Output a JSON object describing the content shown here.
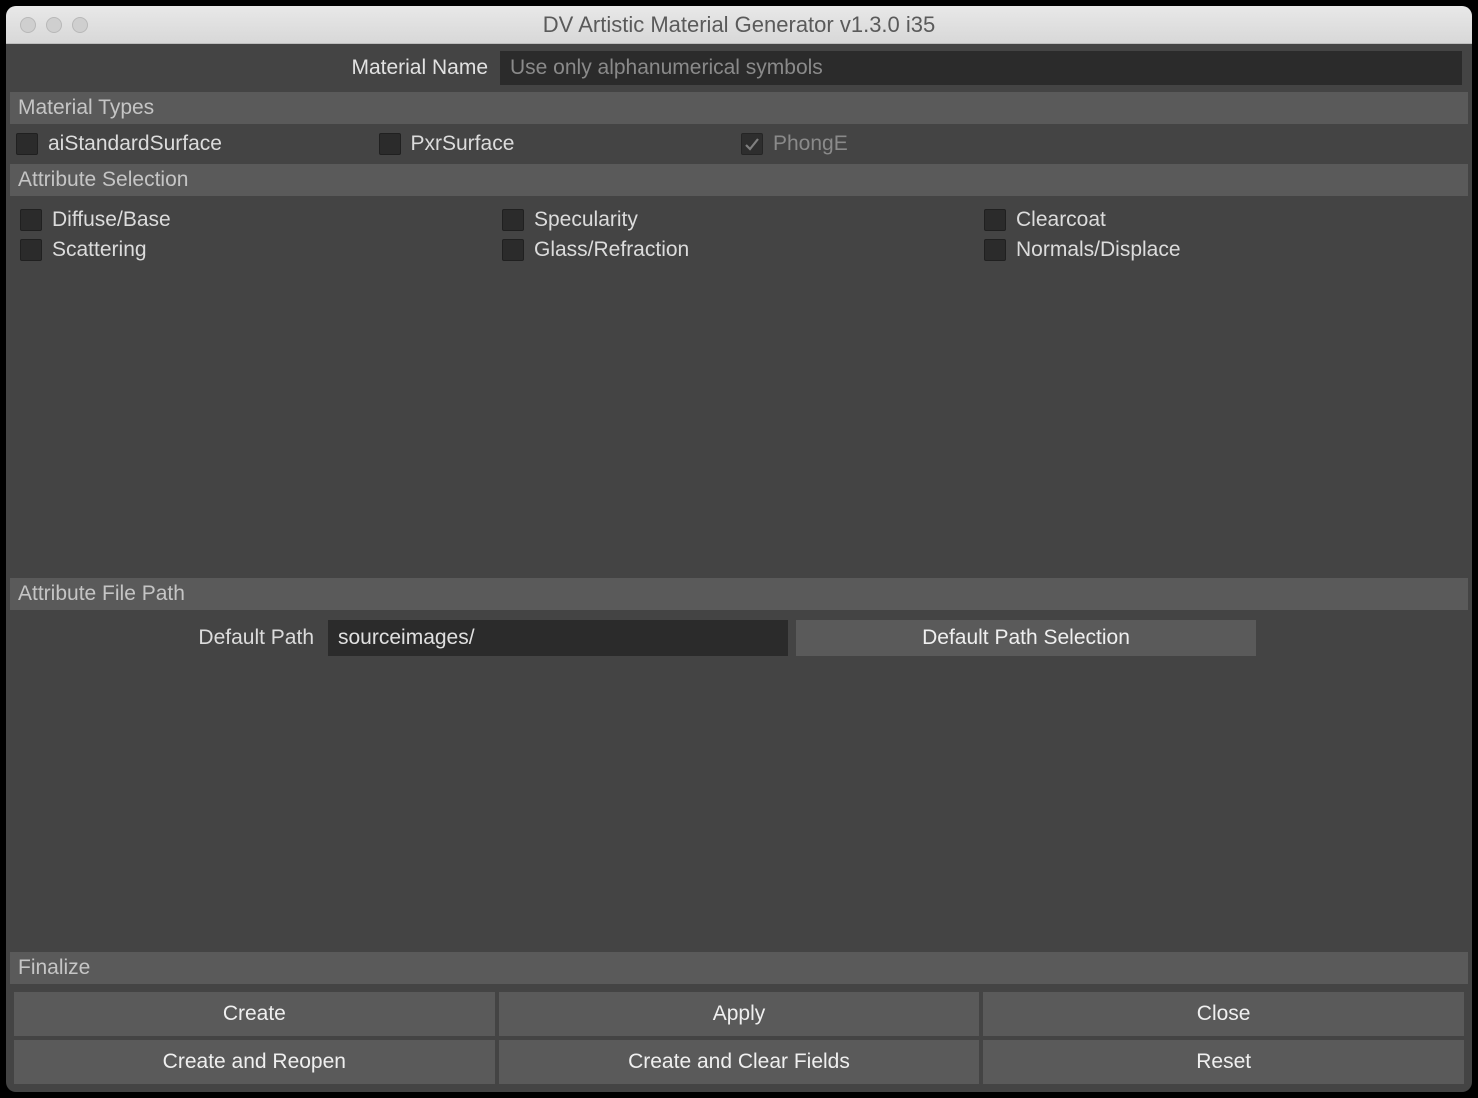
{
  "window": {
    "title": "DV Artistic Material Generator v1.3.0 i35"
  },
  "material_name": {
    "label": "Material Name",
    "placeholder": "Use only alphanumerical symbols",
    "value": ""
  },
  "sections": {
    "material_types": "Material Types",
    "attribute_selection": "Attribute Selection",
    "attribute_file_path": "Attribute File Path",
    "finalize": "Finalize"
  },
  "material_types": [
    {
      "label": "aiStandardSurface",
      "checked": false,
      "enabled": true
    },
    {
      "label": "PxrSurface",
      "checked": false,
      "enabled": true
    },
    {
      "label": "PhongE",
      "checked": true,
      "enabled": false
    }
  ],
  "attributes": [
    {
      "label": "Diffuse/Base",
      "checked": false
    },
    {
      "label": "Specularity",
      "checked": false
    },
    {
      "label": "Clearcoat",
      "checked": false
    },
    {
      "label": "Scattering",
      "checked": false
    },
    {
      "label": "Glass/Refraction",
      "checked": false
    },
    {
      "label": "Normals/Displace",
      "checked": false
    }
  ],
  "path": {
    "label": "Default Path",
    "value": "sourceimages/",
    "button": "Default Path Selection"
  },
  "finalize_buttons": {
    "create": "Create",
    "apply": "Apply",
    "close": "Close",
    "create_reopen": "Create and Reopen",
    "create_clear": "Create and Clear Fields",
    "reset": "Reset"
  }
}
